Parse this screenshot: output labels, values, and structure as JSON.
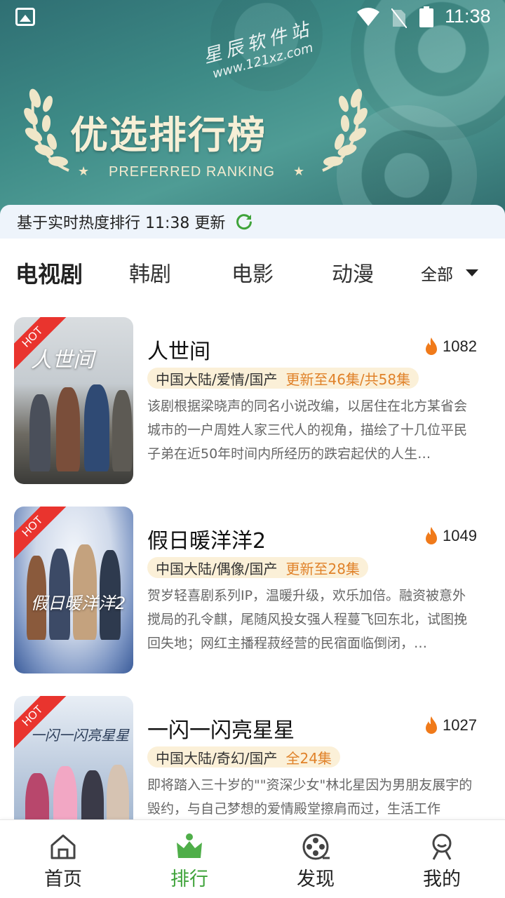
{
  "status_bar": {
    "time": "11:38"
  },
  "banner": {
    "watermark_cn": "星辰软件站",
    "watermark_url": "www.121xz.com",
    "title": "优选排行榜",
    "subtitle": "PREFERRED RANKING"
  },
  "update_bar": {
    "text": "基于实时热度排行 11:38 更新"
  },
  "tabs": [
    {
      "label": "电视剧",
      "active": true
    },
    {
      "label": "韩剧",
      "active": false
    },
    {
      "label": "电影",
      "active": false
    },
    {
      "label": "动漫",
      "active": false
    }
  ],
  "filter": {
    "label": "全部"
  },
  "items": [
    {
      "badge": "HOT",
      "poster_text": "人世间",
      "title": "人世间",
      "heat": "1082",
      "region": "中国大陆/爱情/国产",
      "episodes": "更新至46集/共58集",
      "desc": "该剧根据梁晓声的同名小说改编，以居住在北方某省会城市的一户周姓人家三代人的视角，描绘了十几位平民子弟在近50年时间内所经历的跌宕起伏的人生…"
    },
    {
      "badge": "HOT",
      "poster_text": "假日暖洋洋2",
      "title": "假日暖洋洋2",
      "heat": "1049",
      "region": "中国大陆/偶像/国产",
      "episodes": "更新至28集",
      "desc": "贺岁轻喜剧系列IP，温暖升级，欢乐加倍。融资被意外搅局的孔令麒，尾随风投女强人程蔓飞回东北，试图挽回失地；网红主播程菽经营的民宿面临倒闭，…"
    },
    {
      "badge": "HOT",
      "poster_text": "一闪一闪亮星星",
      "title": "一闪一闪亮星星",
      "heat": "1027",
      "region": "中国大陆/奇幻/国产",
      "episodes": "全24集",
      "desc": "即将踏入三十岁的\"\"资深少女\"林北星因为男朋友展宇的毁约，与自己梦想的爱情殿堂擦肩而过，生活工作"
    }
  ],
  "bottom_nav": [
    {
      "label": "首页",
      "icon": "home-icon",
      "active": false
    },
    {
      "label": "排行",
      "icon": "crown-icon",
      "active": true
    },
    {
      "label": "发现",
      "icon": "film-reel-icon",
      "active": false
    },
    {
      "label": "我的",
      "icon": "user-icon",
      "active": false
    }
  ],
  "colors": {
    "accent": "#3fa33a",
    "hot_badge": "#e9342e",
    "episodes": "#e0822a",
    "banner": "#3d8a86"
  }
}
